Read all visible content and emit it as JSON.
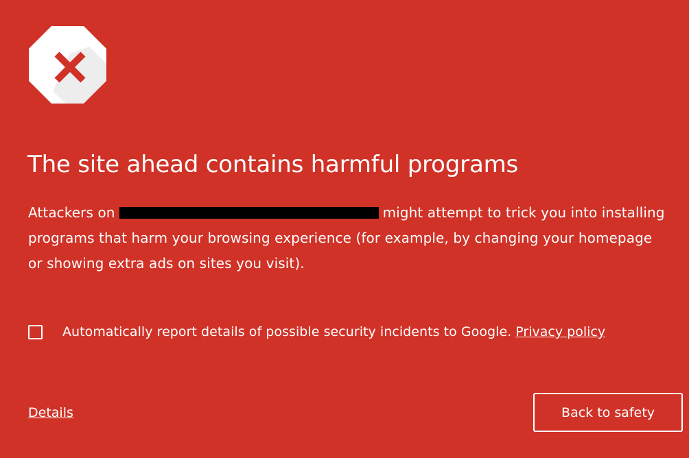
{
  "colors": {
    "background": "#d03227",
    "foreground": "#ffffff",
    "icon_fill": "#ffffff",
    "icon_cross": "#d03227",
    "redaction": "#000000"
  },
  "icon": {
    "name": "stop-sign-x-icon"
  },
  "heading": "The site ahead contains harmful programs",
  "message": {
    "prefix": "Attackers on",
    "redacted_site": "",
    "suffix": "might attempt to trick you into installing programs that harm your browsing experience (for example, by changing your homepage or showing extra ads on sites you visit)."
  },
  "report": {
    "checked": false,
    "label": "Automatically report details of possible security incidents to Google.",
    "privacy_link": "Privacy policy"
  },
  "footer": {
    "details_link": "Details",
    "back_button": "Back to safety"
  }
}
